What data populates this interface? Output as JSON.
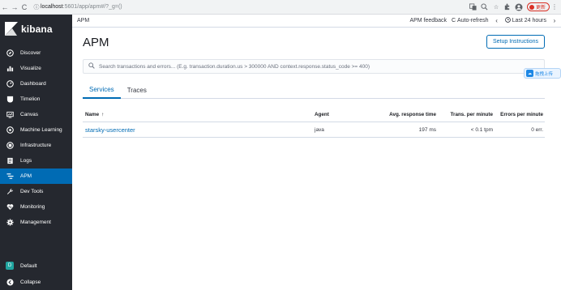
{
  "browser": {
    "url_host": "localhost",
    "url_path": ":5601/app/apm#/?_g=()",
    "update_label": "更新"
  },
  "sidebar": {
    "brand": "kibana",
    "items": [
      {
        "label": "Discover",
        "icon": "compass-icon"
      },
      {
        "label": "Visualize",
        "icon": "bar-chart-icon"
      },
      {
        "label": "Dashboard",
        "icon": "dashboard-icon"
      },
      {
        "label": "Timelion",
        "icon": "shield-icon"
      },
      {
        "label": "Canvas",
        "icon": "canvas-icon"
      },
      {
        "label": "Machine Learning",
        "icon": "ml-icon"
      },
      {
        "label": "Infrastructure",
        "icon": "infra-icon"
      },
      {
        "label": "Logs",
        "icon": "logs-icon"
      },
      {
        "label": "APM",
        "icon": "apm-icon"
      },
      {
        "label": "Dev Tools",
        "icon": "wrench-icon"
      },
      {
        "label": "Monitoring",
        "icon": "heartbeat-icon"
      },
      {
        "label": "Management",
        "icon": "gear-icon"
      }
    ],
    "active_index": 8,
    "space_initial": "D",
    "space_label": "Default",
    "collapse_label": "Collapse"
  },
  "topbar": {
    "breadcrumb": "APM",
    "feedback": "APM feedback",
    "auto_refresh": "Auto-refresh",
    "time_range": "Last 24 hours"
  },
  "main": {
    "title": "APM",
    "setup_button": "Setup Instructions",
    "search_placeholder": "Search transactions and errors... (E.g. transaction.duration.us > 300000 AND context.response.status_code >= 400)",
    "tabs": [
      {
        "label": "Services",
        "active": true
      },
      {
        "label": "Traces",
        "active": false
      }
    ],
    "table": {
      "columns": {
        "name": "Name",
        "agent": "Agent",
        "avg": "Avg. response time",
        "tpm": "Trans. per minute",
        "err": "Errors per minute"
      },
      "rows": [
        {
          "name": "starsky-usercenter",
          "agent": "java",
          "avg": "197 ms",
          "tpm": "< 0.1 tpm",
          "err": "0 err."
        }
      ]
    }
  },
  "float_badge": {
    "label": "拖拽上传"
  },
  "colors": {
    "sidebar_bg": "#25282f",
    "active_bg": "#006bb4",
    "link": "#006bb4"
  }
}
